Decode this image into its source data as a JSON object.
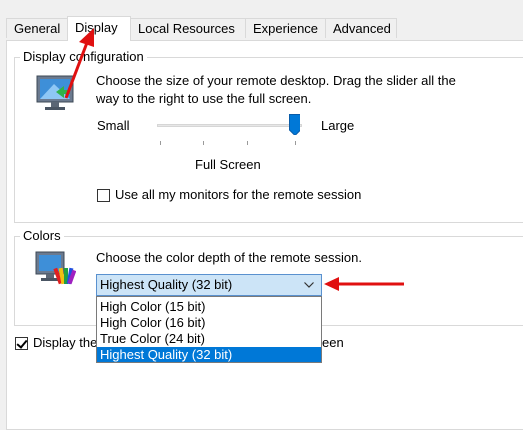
{
  "tabs": [
    {
      "label": "General"
    },
    {
      "label": "Display"
    },
    {
      "label": "Local Resources"
    },
    {
      "label": "Experience"
    },
    {
      "label": "Advanced"
    }
  ],
  "display_config": {
    "legend": "Display configuration",
    "description": "Choose the size of your remote desktop. Drag the slider all the way to the right to use the full screen.",
    "slider_min_label": "Small",
    "slider_max_label": "Large",
    "slider_value_label": "Full Screen",
    "slider_value": 1.0,
    "monitors_label": "Use all my monitors for the remote session",
    "monitors_checked": false
  },
  "colors": {
    "legend": "Colors",
    "description": "Choose the color depth of the remote session.",
    "selected": "Highest Quality (32 bit)",
    "options": [
      "High Color (15 bit)",
      "High Color (16 bit)",
      "True Color (24 bit)",
      "Highest Quality (32 bit)"
    ]
  },
  "connection_bar": {
    "label_visible_start": "Display the",
    "label_visible_end": "een",
    "checked": true
  },
  "accent_colors": {
    "selection": "#0078d7",
    "annotation_arrow": "#e01010"
  },
  "icons": [
    "monitor-display-icon",
    "color-palette-monitor-icon",
    "chevron-down-icon",
    "annotation-arrow-icon"
  ]
}
